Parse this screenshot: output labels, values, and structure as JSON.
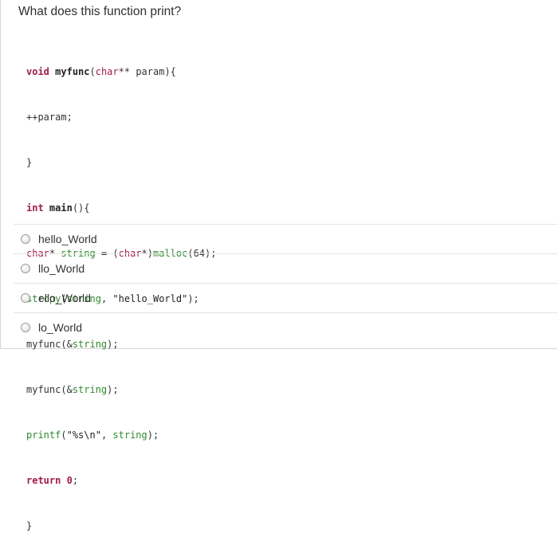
{
  "question": "What does this function print?",
  "code_lines": [
    [
      "void",
      " ",
      "myfunc",
      "(",
      "char",
      "** ",
      "param",
      "){"
    ],
    [
      "++param;"
    ],
    [
      "}"
    ],
    [
      "int",
      " ",
      "main",
      "(){"
    ],
    [
      "char",
      "* ",
      "string",
      " = ",
      "(",
      "char",
      "*)",
      "malloc",
      "(64);"
    ],
    [
      "strcpy",
      "(",
      "string",
      ", ",
      "\"hello_World\"",
      ");"
    ],
    [
      "myfunc",
      "(&",
      "string",
      ");"
    ],
    [
      "myfunc",
      "(&",
      "string",
      ");"
    ],
    [
      "printf",
      "(",
      "\"%s\\n\"",
      ", ",
      "string",
      ");"
    ],
    [
      "return",
      " ",
      "0",
      ";"
    ],
    [
      "}"
    ]
  ],
  "options": [
    {
      "label": "hello_World"
    },
    {
      "label": "llo_World"
    },
    {
      "label": "ello_World"
    },
    {
      "label": "lo_World"
    }
  ]
}
